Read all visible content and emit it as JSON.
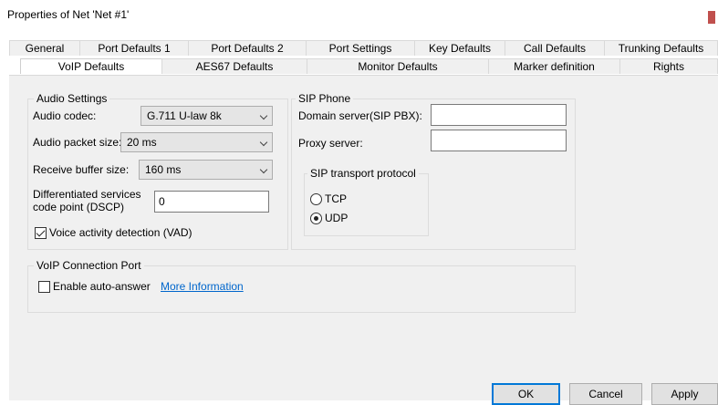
{
  "window": {
    "title": "Properties of Net 'Net #1'"
  },
  "tabs": {
    "row1": [
      "General",
      "Port Defaults 1",
      "Port Defaults 2",
      "Port Settings",
      "Key Defaults",
      "Call Defaults",
      "Trunking Defaults"
    ],
    "row2": [
      "VoIP Defaults",
      "AES67 Defaults",
      "Monitor Defaults",
      "Marker definition",
      "Rights"
    ],
    "active": "VoIP Defaults"
  },
  "audio_settings": {
    "group_label": "Audio Settings",
    "codec_label": "Audio codec:",
    "codec_value": "G.711 U-law 8k",
    "packet_label": "Audio packet size:",
    "packet_value": "20 ms",
    "buffer_label": "Receive buffer size:",
    "buffer_value": "160 ms",
    "dscp_label_line1": "Differentiated services",
    "dscp_label_line2": "code point (DSCP)",
    "dscp_value": "0",
    "vad_label": "Voice activity detection (VAD)",
    "vad_checked": true
  },
  "sip_phone": {
    "group_label": "SIP Phone",
    "domain_label": "Domain server(SIP PBX):",
    "domain_value": "",
    "proxy_label": "Proxy server:",
    "proxy_value": "",
    "transport_group_label": "SIP transport protocol",
    "tcp_label": "TCP",
    "udp_label": "UDP",
    "selected": "UDP"
  },
  "voip_port": {
    "group_label": "VoIP Connection Port",
    "auto_answer_label": "Enable auto-answer",
    "auto_answer_checked": false,
    "more_info_link": "More Information"
  },
  "buttons": {
    "ok": "OK",
    "cancel": "Cancel",
    "apply": "Apply"
  },
  "colors": {
    "accent": "#0078d7",
    "link": "#0066cc",
    "close": "#c0504d",
    "panel": "#f0f0f0"
  }
}
